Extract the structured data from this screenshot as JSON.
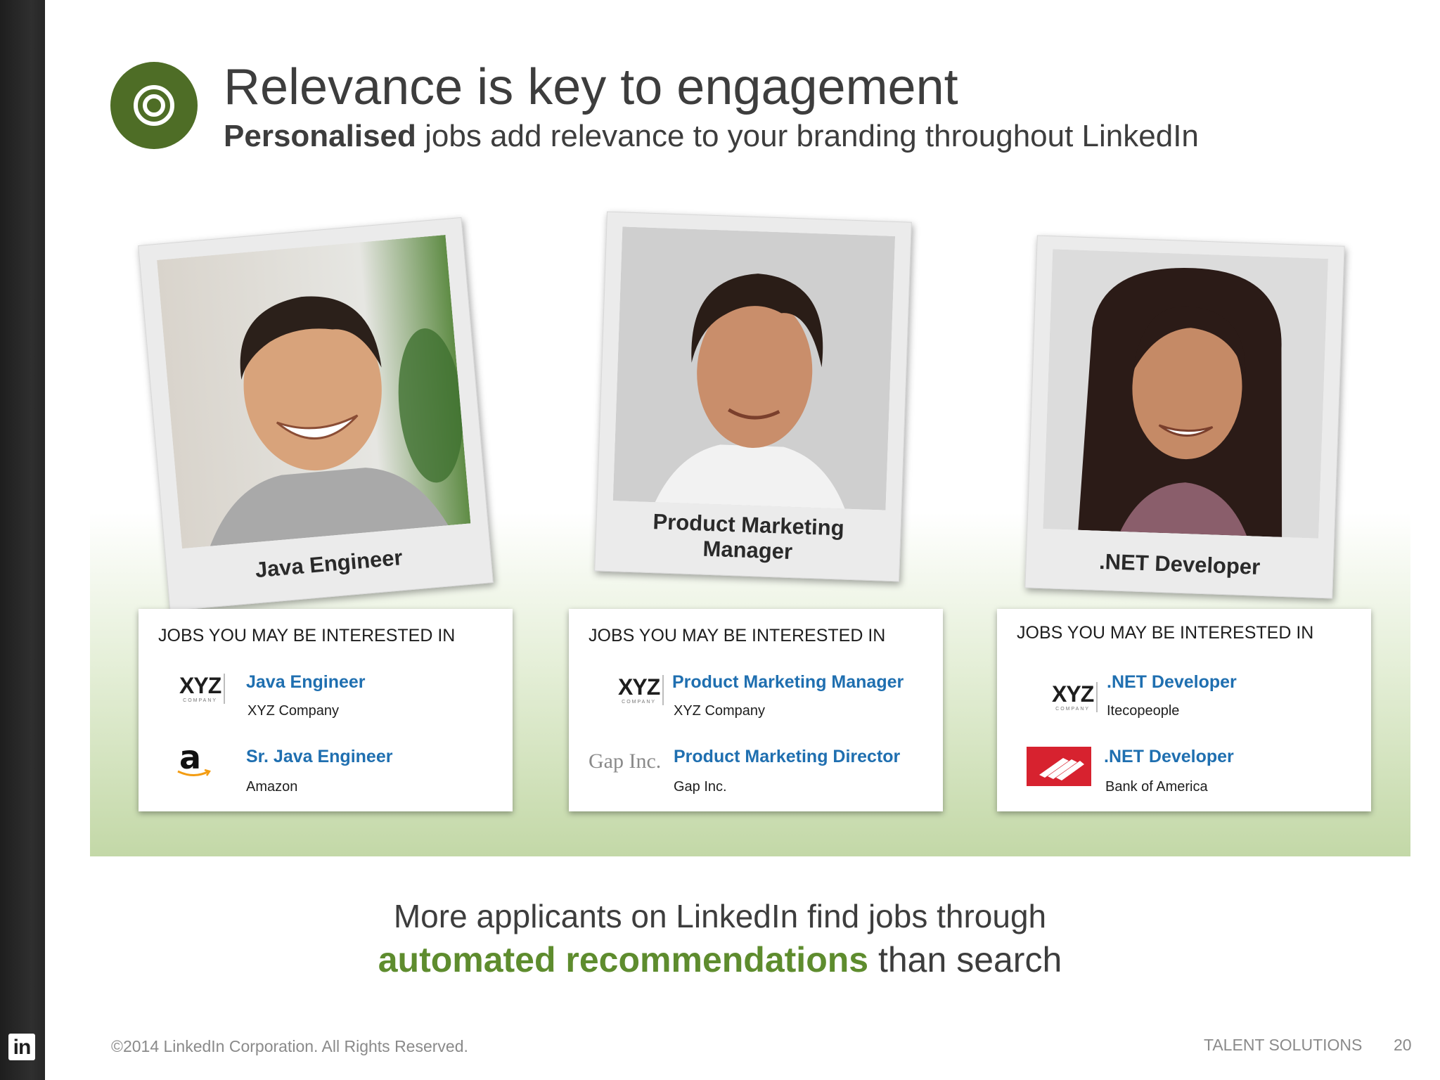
{
  "slide": {
    "title": "Relevance is key to engagement",
    "subtitle_bold": "Personalised",
    "subtitle_rest": " jobs add relevance to your branding throughout LinkedIn",
    "icon": "target-icon"
  },
  "profiles": [
    {
      "role": "Java Engineer",
      "card": {
        "heading": "JOBS YOU MAY BE INTERESTED IN",
        "jobs": [
          {
            "title": "Java Engineer",
            "company": "XYZ Company",
            "logo": "XYZ",
            "logo_sub": "COMPANY"
          },
          {
            "title": "Sr. Java Engineer",
            "company": "Amazon",
            "logo": "a"
          }
        ]
      }
    },
    {
      "role_line1": "Product Marketing",
      "role_line2": "Manager",
      "card": {
        "heading": "JOBS YOU MAY BE INTERESTED IN",
        "jobs": [
          {
            "title": "Product Marketing Manager",
            "company": "XYZ Company",
            "logo": "XYZ",
            "logo_sub": "COMPANY"
          },
          {
            "title": "Product Marketing Director",
            "company": "Gap Inc.",
            "logo": "Gap Inc."
          }
        ]
      }
    },
    {
      "role": ".NET Developer",
      "card": {
        "heading": "JOBS YOU MAY BE INTERESTED IN",
        "jobs": [
          {
            "title": ".NET Developer",
            "company": "Itecopeople",
            "logo": "XYZ",
            "logo_sub": "COMPANY"
          },
          {
            "title": ".NET Developer",
            "company": "Bank of America",
            "logo": "bank-of-america-logo"
          }
        ]
      }
    }
  ],
  "tagline": {
    "line1": "More applicants on LinkedIn find jobs through",
    "highlight": "automated recommendations",
    "rest": " than search"
  },
  "footer": {
    "logo": "in",
    "copyright": "©2014 LinkedIn Corporation. All Rights Reserved.",
    "brand": "TALENT SOLUTIONS",
    "page": "20"
  },
  "colors": {
    "accent_green": "#5e8c2e",
    "icon_green": "#4e6d26",
    "link_blue": "#1f6fb0",
    "sidebar": "#2a2a2a",
    "boa_red": "#d7222f"
  }
}
